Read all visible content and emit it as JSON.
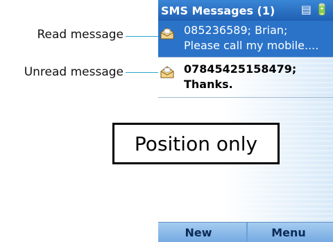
{
  "callouts": {
    "read": "Read message",
    "unread": "Unread message"
  },
  "titlebar": {
    "title": "SMS Messages (1)",
    "status_icons": "signal-battery"
  },
  "messages": [
    {
      "state": "read",
      "line1": "085236589; Brian;",
      "line2": "Please call my mobile....",
      "icon": "open-envelope-icon"
    },
    {
      "state": "unread",
      "line1": "07845425158479;",
      "line2": "Thanks.",
      "icon": "envelope-icon"
    }
  ],
  "softkeys": {
    "left": "New",
    "right": "Menu"
  },
  "overlay": {
    "text": "Position only"
  },
  "colors": {
    "accent": "#2a73c9",
    "callout_line": "#2aa6c9"
  }
}
